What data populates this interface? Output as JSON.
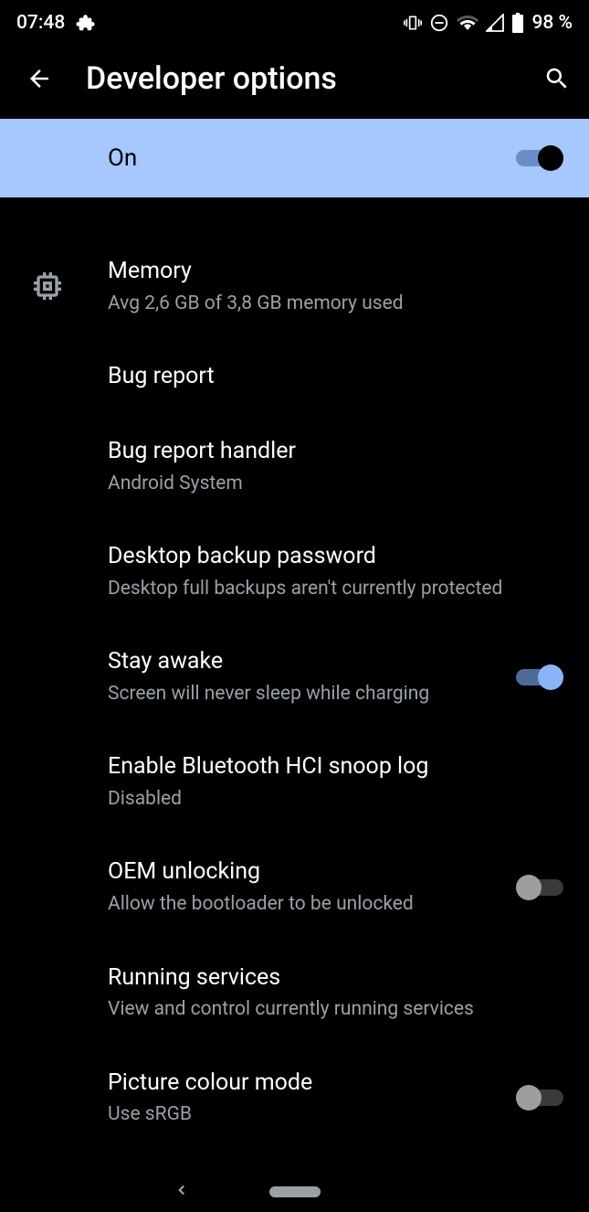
{
  "status": {
    "time": "07:48",
    "battery": "98 %"
  },
  "header": {
    "title": "Developer options"
  },
  "master": {
    "label": "On",
    "enabled": true
  },
  "items": [
    {
      "title": "Memory",
      "subtitle": "Avg 2,6 GB of 3,8 GB memory used",
      "icon": "memory",
      "toggle": null
    },
    {
      "title": "Bug report",
      "subtitle": "",
      "icon": "",
      "toggle": null
    },
    {
      "title": "Bug report handler",
      "subtitle": "Android System",
      "icon": "",
      "toggle": null
    },
    {
      "title": "Desktop backup password",
      "subtitle": "Desktop full backups aren't currently protected",
      "icon": "",
      "toggle": null
    },
    {
      "title": "Stay awake",
      "subtitle": "Screen will never sleep while charging",
      "icon": "",
      "toggle": true
    },
    {
      "title": "Enable Bluetooth HCI snoop log",
      "subtitle": "Disabled",
      "icon": "",
      "toggle": null
    },
    {
      "title": "OEM unlocking",
      "subtitle": "Allow the bootloader to be unlocked",
      "icon": "",
      "toggle": false
    },
    {
      "title": "Running services",
      "subtitle": "View and control currently running services",
      "icon": "",
      "toggle": null
    },
    {
      "title": "Picture colour mode",
      "subtitle": "Use sRGB",
      "icon": "",
      "toggle": false
    }
  ]
}
